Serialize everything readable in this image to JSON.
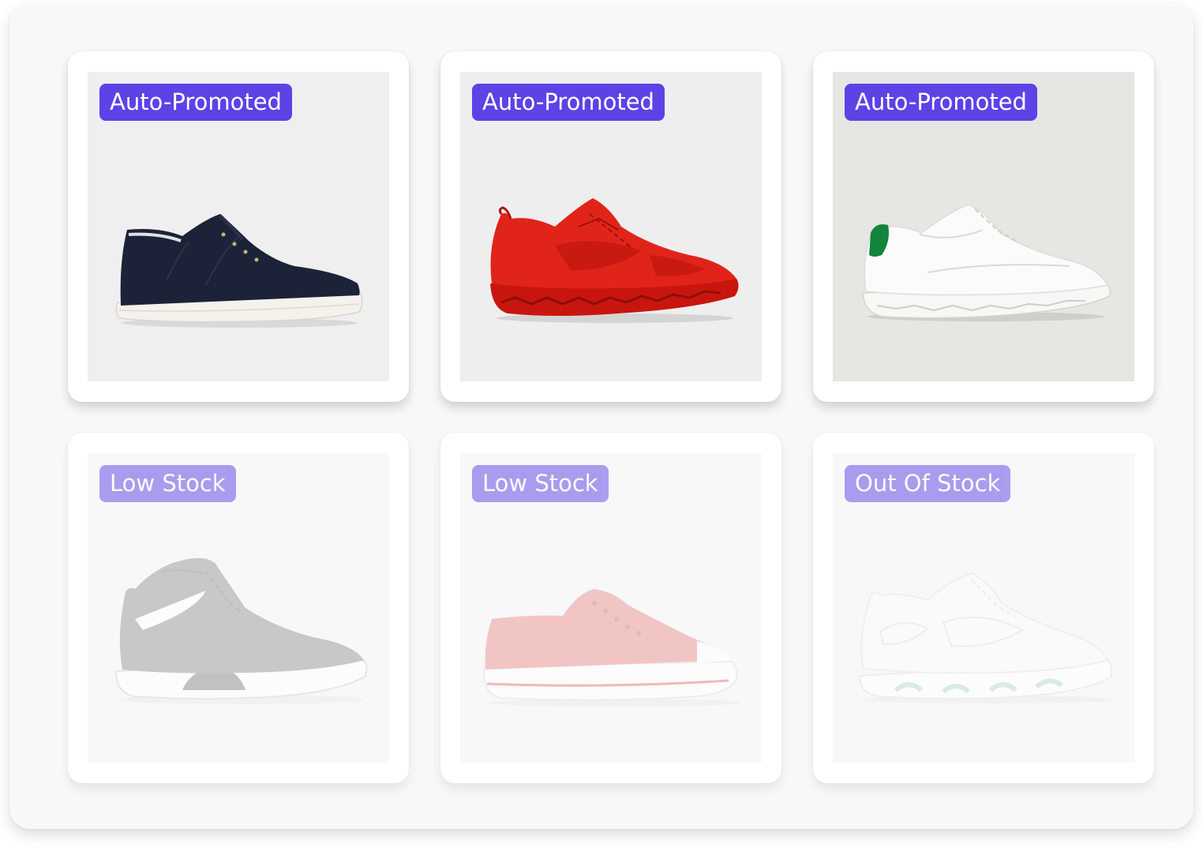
{
  "colors": {
    "badge": "#5b43e6",
    "panel": "#f8f8f9",
    "photo_bg_gray": "#eeeeee",
    "photo_bg_warm": "#e6e6e2"
  },
  "products": [
    {
      "badge": "Auto-Promoted",
      "status": "active",
      "shoe_icon": "navy-low-top-sneaker-icon"
    },
    {
      "badge": "Auto-Promoted",
      "status": "active",
      "shoe_icon": "red-running-shoe-icon"
    },
    {
      "badge": "Auto-Promoted",
      "status": "active",
      "shoe_icon": "white-green-heel-sneaker-icon"
    },
    {
      "badge": "Low Stock",
      "status": "dimmed",
      "shoe_icon": "gray-high-top-sneaker-icon"
    },
    {
      "badge": "Low Stock",
      "status": "dimmed",
      "shoe_icon": "red-canvas-sneaker-icon"
    },
    {
      "badge": "Out Of Stock",
      "status": "dimmed",
      "shoe_icon": "white-chunky-sneaker-icon"
    }
  ]
}
